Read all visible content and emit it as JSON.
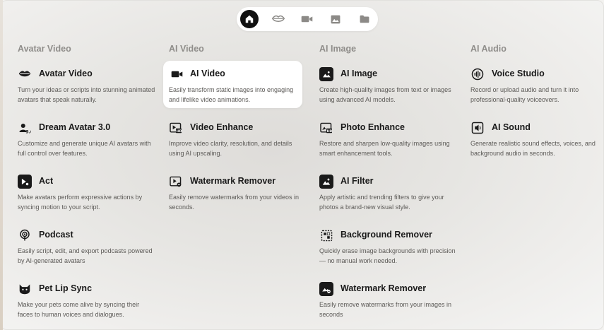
{
  "nav": {
    "items": [
      {
        "icon": "home-icon",
        "active": true
      },
      {
        "icon": "lips-icon",
        "active": false
      },
      {
        "icon": "video-camera-icon",
        "active": false
      },
      {
        "icon": "image-icon",
        "active": false
      },
      {
        "icon": "folder-icon",
        "active": false
      }
    ]
  },
  "columns": [
    {
      "heading": "Avatar Video",
      "items": [
        {
          "icon": "lips-icon",
          "title": "Avatar Video",
          "desc": "Turn your ideas or scripts into stunning animated avatars that speak naturally."
        },
        {
          "icon": "dream-avatar-icon",
          "title": "Dream Avatar 3.0",
          "desc": "Customize and generate unique AI avatars with full control over features."
        },
        {
          "icon": "act-icon",
          "title": "Act",
          "desc": "Make avatars perform expressive actions by syncing motion to your script."
        },
        {
          "icon": "podcast-icon",
          "title": "Podcast",
          "desc": "Easily script, edit, and export podcasts powered by AI-generated avatars"
        },
        {
          "icon": "cat-icon",
          "title": "Pet Lip Sync",
          "desc": "Make your pets come alive by syncing their faces to human voices and dialogues."
        }
      ]
    },
    {
      "heading": "AI Video",
      "items": [
        {
          "icon": "video-camera-icon",
          "title": "AI Video",
          "desc": "Easily transform static images into engaging and lifelike video animations.",
          "highlight": true
        },
        {
          "icon": "hd-video-icon",
          "title": "Video Enhance",
          "desc": "Improve video clarity, resolution, and details using AI upscaling."
        },
        {
          "icon": "video-watermark-icon",
          "title": "Watermark Remover",
          "desc": "Easily remove watermarks from your videos in seconds."
        }
      ]
    },
    {
      "heading": "AI Image",
      "items": [
        {
          "icon": "image-icon",
          "title": "AI Image",
          "desc": "Create high-quality images from text or images using advanced AI models."
        },
        {
          "icon": "hd-image-icon",
          "title": "Photo Enhance",
          "desc": "Restore and sharpen low-quality images using smart enhancement tools."
        },
        {
          "icon": "filter-icon",
          "title": "AI Filter",
          "desc": "Apply artistic and trending filters to give your photos a brand-new visual style."
        },
        {
          "icon": "background-remover-icon",
          "title": "Background Remover",
          "desc": "Quickly erase image backgrounds with precision — no manual work needed."
        },
        {
          "icon": "image-watermark-icon",
          "title": "Watermark Remover",
          "desc": "Easily remove watermarks from your images in seconds"
        }
      ]
    },
    {
      "heading": "AI Audio",
      "items": [
        {
          "icon": "voice-wave-icon",
          "title": "Voice Studio",
          "desc": "Record or upload audio and turn it into professional-quality voiceovers."
        },
        {
          "icon": "sound-icon",
          "title": "AI Sound",
          "desc": "Generate realistic sound effects, voices, and background audio in seconds."
        }
      ]
    }
  ]
}
